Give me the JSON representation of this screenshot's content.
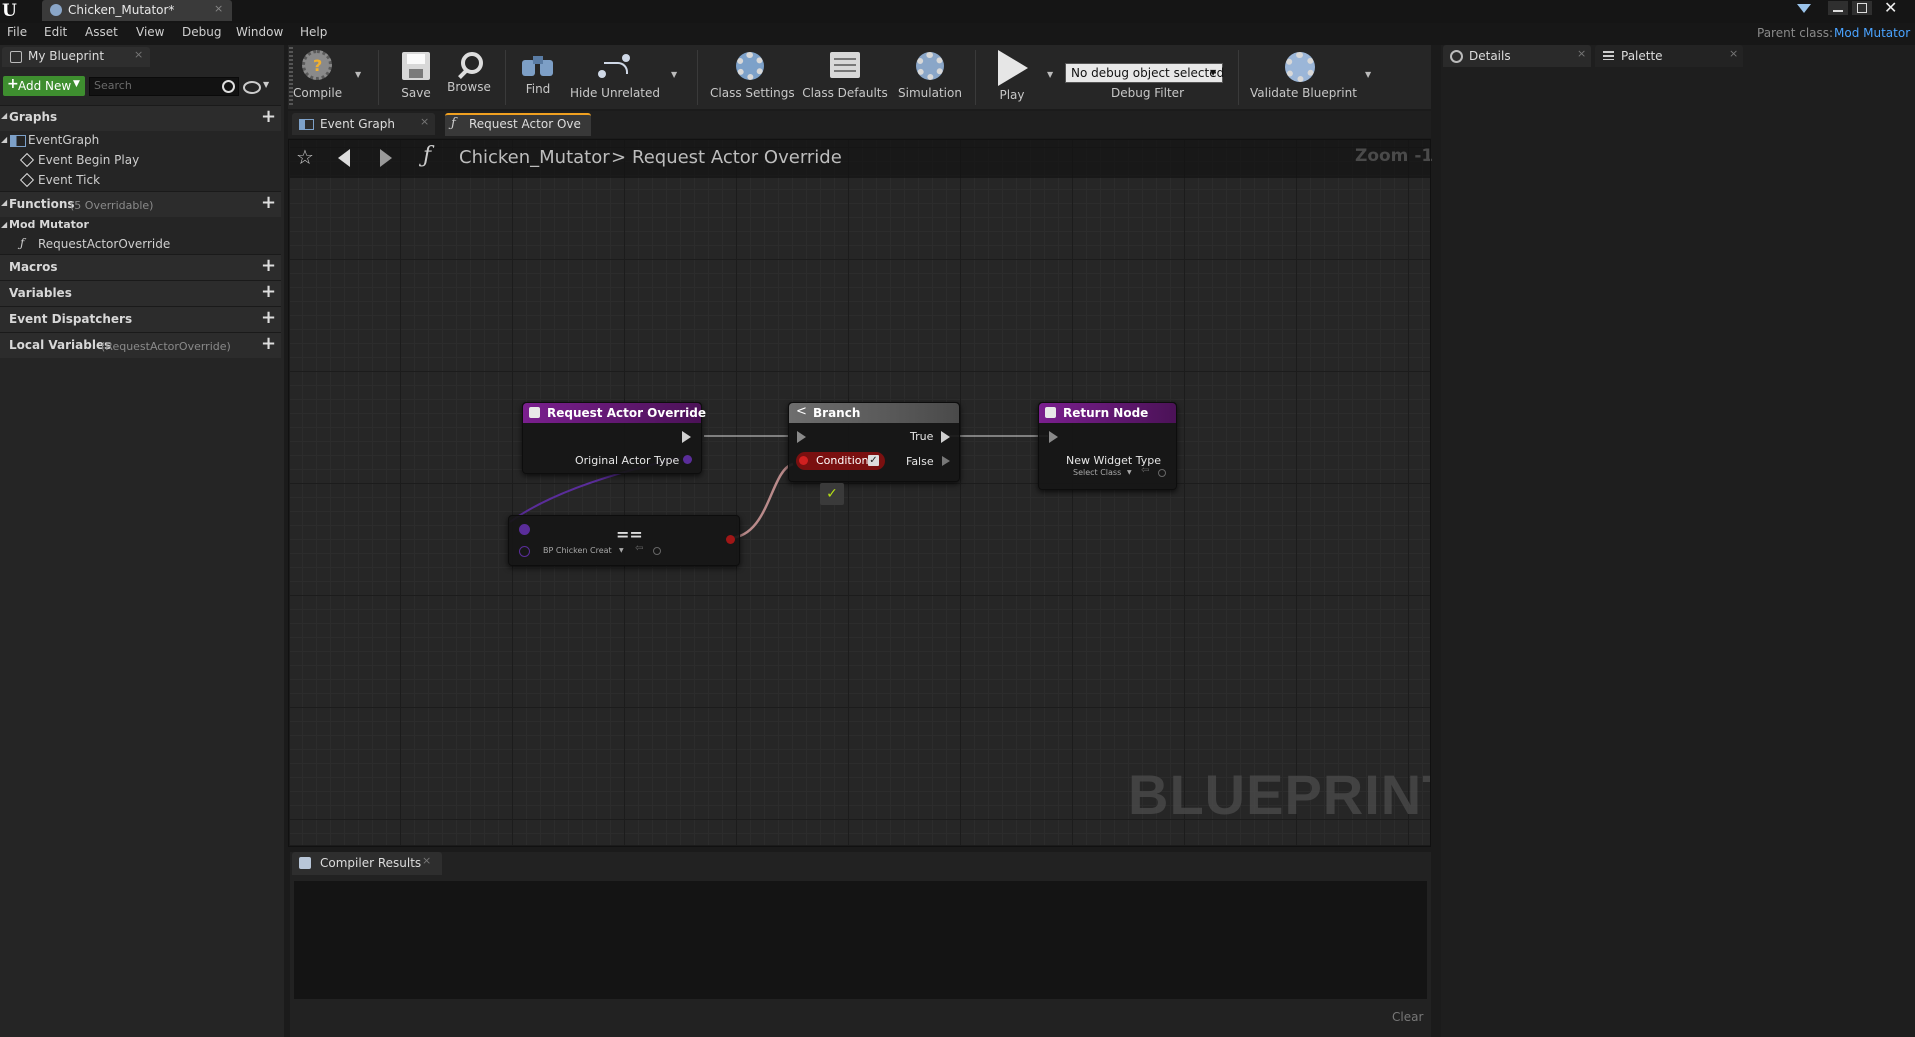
{
  "window": {
    "tab_title": "Chicken_Mutator*",
    "parent_class_label": "Parent class:",
    "parent_class_value": "Mod Mutator",
    "accent": "#4aa3ff"
  },
  "menu": [
    "File",
    "Edit",
    "Asset",
    "View",
    "Debug",
    "Window",
    "Help"
  ],
  "left_panel": {
    "tab": "My Blueprint",
    "add_new": "Add New",
    "search_placeholder": "Search",
    "graphs": {
      "title": "Graphs",
      "event_graph": "EventGraph",
      "items": [
        "Event Begin Play",
        "Event Tick"
      ]
    },
    "functions": {
      "title": "Functions",
      "note": "(5 Overridable)"
    },
    "category": "Mod Mutator",
    "function_item": "RequestActorOverride",
    "macros": "Macros",
    "variables": "Variables",
    "dispatchers": "Event Dispatchers",
    "local_vars": {
      "title": "Local Variables",
      "note": "(RequestActorOverride)"
    }
  },
  "toolbar": {
    "compile": "Compile",
    "save": "Save",
    "browse": "Browse",
    "find": "Find",
    "hide_unrelated": "Hide Unrelated",
    "class_settings": "Class Settings",
    "class_defaults": "Class Defaults",
    "simulation": "Simulation",
    "play": "Play",
    "debug_select": "No debug object selected",
    "debug_filter": "Debug Filter",
    "validate": "Validate Blueprint"
  },
  "graph": {
    "tabs": [
      "Event Graph",
      "Request Actor Ove"
    ],
    "breadcrumb_root": "Chicken_Mutator",
    "breadcrumb_sep": ">",
    "breadcrumb_current": "Request Actor Override",
    "zoom": "Zoom -1",
    "watermark": "BLUEPRINT",
    "nodes": {
      "entry": {
        "title": "Request Actor Override",
        "pin": "Original Actor Type"
      },
      "equal": {
        "symbol": "==",
        "select": "BP Chicken Creat"
      },
      "branch": {
        "title": "Branch",
        "true": "True",
        "false": "False",
        "condition": "Condition"
      },
      "ret": {
        "title": "Return Node",
        "pin": "New Widget Type",
        "select": "Select Class"
      }
    }
  },
  "right_panel": {
    "details": "Details",
    "palette": "Palette"
  },
  "compiler": {
    "tab": "Compiler Results",
    "clear": "Clear"
  }
}
